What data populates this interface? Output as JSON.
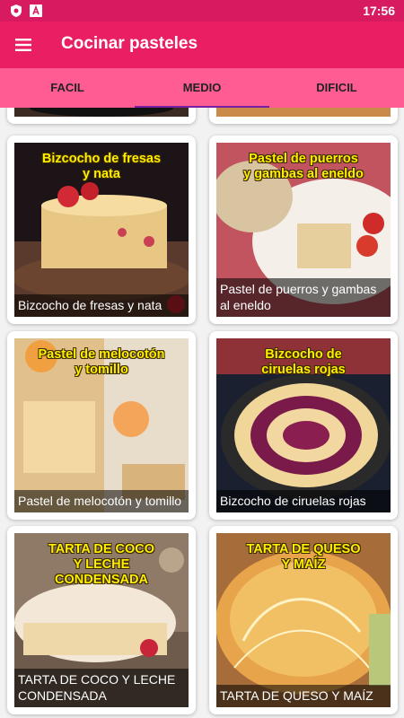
{
  "status_bar": {
    "time": "17:56",
    "icons": [
      "shield-icon",
      "a-badge-icon"
    ]
  },
  "app_bar": {
    "menu_icon": "hamburger-menu-icon",
    "title": "Cocinar pasteles"
  },
  "tabs": [
    {
      "label": "FACIL",
      "active": false
    },
    {
      "label": "MEDIO",
      "active": true
    },
    {
      "label": "DIFICIL",
      "active": false
    }
  ],
  "recipes": [
    {
      "headline": "Bizcocho de fresas\ny nata",
      "title": "Bizcocho de fresas y nata"
    },
    {
      "headline": "Pastel de puerros\ny gambas al eneldo",
      "title": "Pastel de puerros y gambas al eneldo"
    },
    {
      "headline": "Pastel de melocotón\ny tomillo",
      "title": "Pastel de melocotón y tomillo"
    },
    {
      "headline": "Bizcocho de\nciruelas rojas",
      "title": "Bizcocho de ciruelas rojas"
    },
    {
      "headline": "TARTA DE COCO\nY LECHE\nCONDENSADA",
      "title": "TARTA DE COCO Y LECHE CONDENSADA"
    },
    {
      "headline": "TARTA DE QUESO\nY MAÍZ",
      "title": "TARTA DE QUESO Y MAÍZ"
    }
  ],
  "colors": {
    "status_bar": "#d81b60",
    "app_bar": "#e91e63",
    "tab_bar": "#ff5c93",
    "tab_indicator": "#7b1fa2",
    "headline": "#ffee00"
  }
}
